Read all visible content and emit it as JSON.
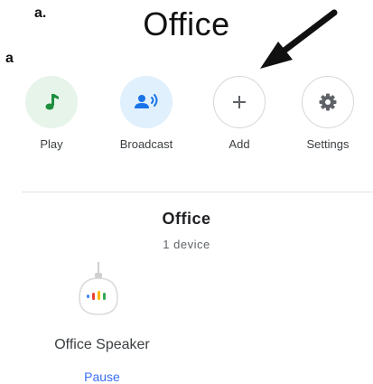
{
  "annotations": {
    "label_top": "a.",
    "label_side": "a"
  },
  "header": {
    "title": "Office"
  },
  "actions": [
    {
      "label": "Play",
      "icon": "music-note-icon",
      "color": "#1e8e3e"
    },
    {
      "label": "Broadcast",
      "icon": "broadcast-person-icon",
      "color": "#1a73e8"
    },
    {
      "label": "Add",
      "icon": "plus-icon",
      "color": "#5f6368"
    },
    {
      "label": "Settings",
      "icon": "gear-icon",
      "color": "#5f6368"
    }
  ],
  "room": {
    "name": "Office",
    "device_count": "1 device"
  },
  "device": {
    "name": "Office Speaker",
    "action": "Pause",
    "icon": "smart-speaker-icon"
  },
  "colors": {
    "accent_link": "#3a6cf4",
    "play_bg": "#e6f4ea",
    "broadcast_bg": "#e0f0fd"
  }
}
